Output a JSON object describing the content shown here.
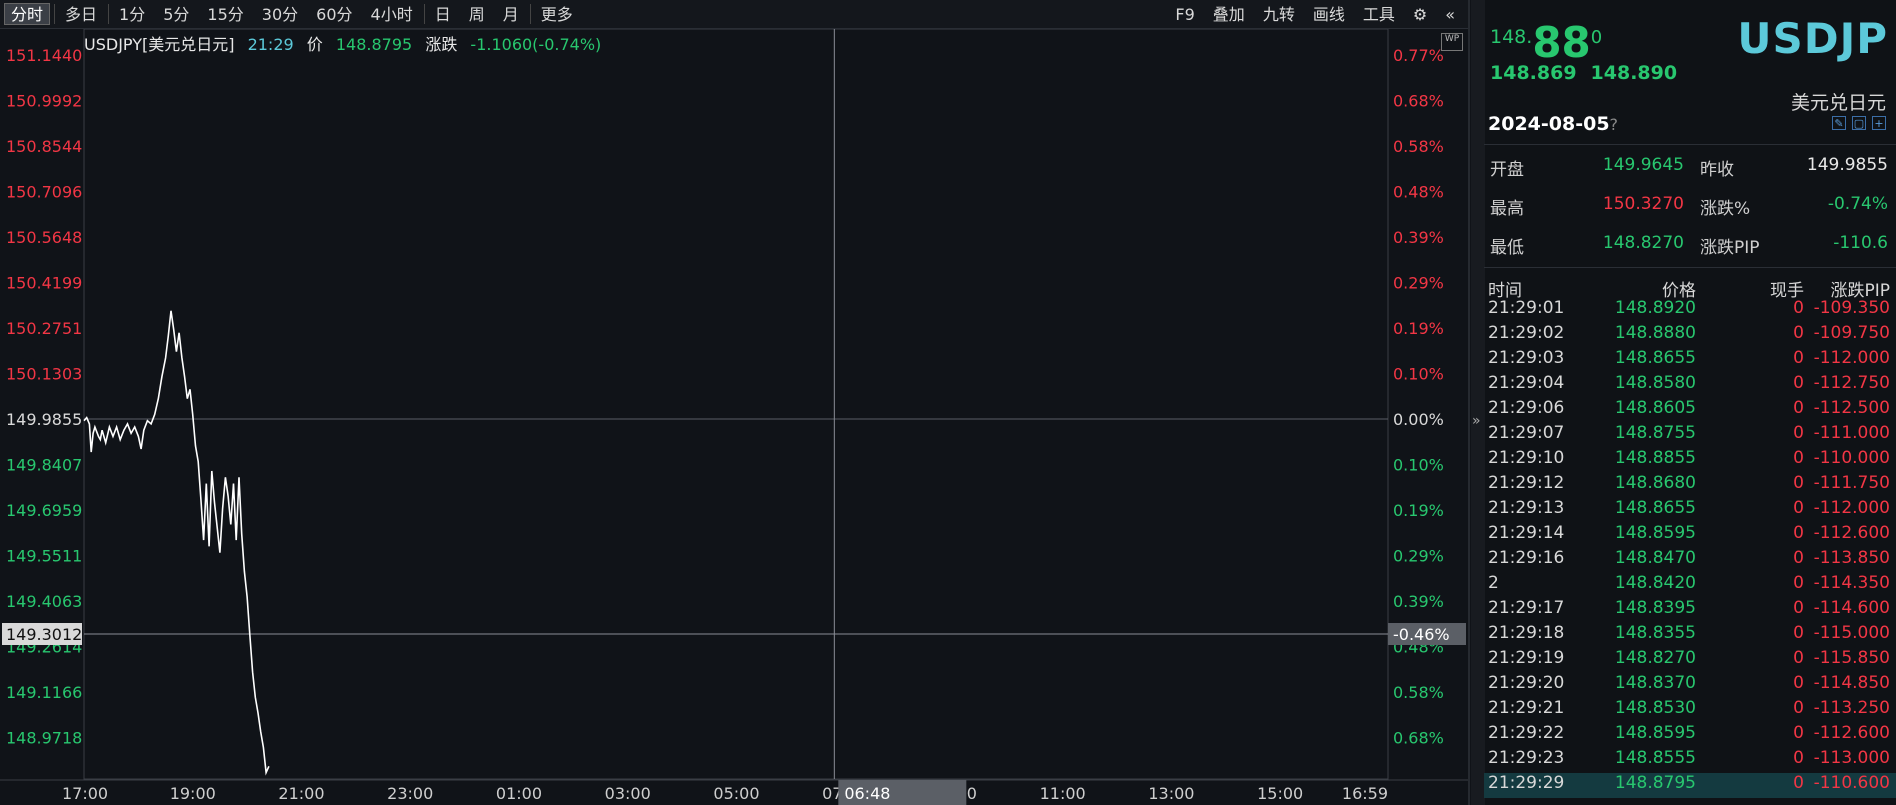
{
  "toolbar": {
    "periods": [
      {
        "label": "分时",
        "active": true
      },
      {
        "label": "多日",
        "active": false
      },
      {
        "label": "1分",
        "active": false
      },
      {
        "label": "5分",
        "active": false
      },
      {
        "label": "15分",
        "active": false
      },
      {
        "label": "30分",
        "active": false
      },
      {
        "label": "60分",
        "active": false
      },
      {
        "label": "4小时",
        "active": false
      },
      {
        "label": "日",
        "active": false
      },
      {
        "label": "周",
        "active": false
      },
      {
        "label": "月",
        "active": false
      },
      {
        "label": "更多",
        "active": false
      }
    ],
    "right": [
      "F9",
      "叠加",
      "九转",
      "画线",
      "工具"
    ],
    "settings_icon": "gear-icon",
    "collapse_icon": "double-chevron-left-icon"
  },
  "info": {
    "symbol": "USDJPY[美元兑日元]",
    "time": "21:29",
    "price_label": "价",
    "price": "148.8795",
    "change_label": "涨跌",
    "change": "-1.1060(-0.74%)"
  },
  "badge": "WP",
  "chart_data": {
    "type": "line",
    "y_ticks": [
      "151.1440",
      "150.9992",
      "150.8544",
      "150.7096",
      "150.5648",
      "150.4199",
      "150.2751",
      "150.1303",
      "149.9855",
      "149.8407",
      "149.6959",
      "149.5511",
      "149.4063",
      "149.2614",
      "149.1166",
      "148.9718"
    ],
    "pct_ticks": [
      "0.77%",
      "0.68%",
      "0.58%",
      "0.48%",
      "0.39%",
      "0.29%",
      "0.19%",
      "0.10%",
      "0.00%",
      "0.10%",
      "0.19%",
      "0.29%",
      "0.39%",
      "0.48%",
      "0.58%",
      "0.68%"
    ],
    "x_ticks": [
      "17:00",
      "19:00",
      "21:00",
      "23:00",
      "01:00",
      "03:00",
      "05:00",
      "07:00",
      "09:00",
      "11:00",
      "13:00",
      "15:00",
      "16:59"
    ],
    "prev_close": 149.9855,
    "ylim": [
      148.85,
      151.17
    ],
    "crosshair": {
      "price_label": "149.3012",
      "pct_label": "-0.46%",
      "time_label": "06:48",
      "price": 149.3012,
      "time_min": 828
    },
    "series": [
      {
        "points": [
          [
            0,
            149.98
          ],
          [
            3,
            149.99
          ],
          [
            6,
            149.97
          ],
          [
            8,
            149.88
          ],
          [
            10,
            149.94
          ],
          [
            12,
            149.96
          ],
          [
            16,
            149.93
          ],
          [
            18,
            149.92
          ],
          [
            20,
            149.95
          ],
          [
            24,
            149.91
          ],
          [
            28,
            149.96
          ],
          [
            32,
            149.93
          ],
          [
            36,
            149.96
          ],
          [
            40,
            149.92
          ],
          [
            44,
            149.95
          ],
          [
            48,
            149.97
          ],
          [
            52,
            149.94
          ],
          [
            56,
            149.96
          ],
          [
            60,
            149.93
          ],
          [
            63,
            149.89
          ],
          [
            66,
            149.95
          ],
          [
            70,
            149.98
          ],
          [
            74,
            149.97
          ],
          [
            78,
            150.0
          ],
          [
            82,
            150.05
          ],
          [
            86,
            150.12
          ],
          [
            90,
            150.18
          ],
          [
            93,
            150.25
          ],
          [
            96,
            150.33
          ],
          [
            99,
            150.27
          ],
          [
            102,
            150.2
          ],
          [
            105,
            150.26
          ],
          [
            108,
            150.18
          ],
          [
            111,
            150.12
          ],
          [
            114,
            150.05
          ],
          [
            117,
            150.08
          ],
          [
            120,
            150.0
          ],
          [
            123,
            149.9
          ],
          [
            126,
            149.85
          ],
          [
            129,
            149.73
          ],
          [
            132,
            149.6
          ],
          [
            135,
            149.78
          ],
          [
            138,
            149.58
          ],
          [
            141,
            149.82
          ],
          [
            144,
            149.72
          ],
          [
            147,
            149.64
          ],
          [
            150,
            149.56
          ],
          [
            153,
            149.7
          ],
          [
            156,
            149.8
          ],
          [
            159,
            149.74
          ],
          [
            162,
            149.65
          ],
          [
            165,
            149.78
          ],
          [
            168,
            149.6
          ],
          [
            171,
            149.8
          ],
          [
            174,
            149.62
          ],
          [
            177,
            149.5
          ],
          [
            180,
            149.42
          ],
          [
            183,
            149.3
          ],
          [
            186,
            149.18
          ],
          [
            189,
            149.1
          ],
          [
            192,
            149.05
          ],
          [
            195,
            148.99
          ],
          [
            198,
            148.94
          ],
          [
            201,
            148.86
          ],
          [
            204,
            148.88
          ]
        ]
      }
    ]
  },
  "panel": {
    "bid_small": "148.",
    "bid_big": "88",
    "bid_tail": "0",
    "symbol": "USDJP",
    "bid": "148.869",
    "ask": "148.890",
    "cname": "美元兑日元",
    "date": "2024-08-05",
    "date_q": "?",
    "quote": {
      "open_label": "开盘",
      "open": "149.9645",
      "prev_label": "昨收",
      "prev": "149.9855",
      "high_label": "最高",
      "high": "150.3270",
      "pct_label": "涨跌%",
      "pct": "-0.74%",
      "low_label": "最低",
      "low": "148.8270",
      "pip_label": "涨跌PIP",
      "pip": "-110.6"
    },
    "ticks_head": {
      "time": "时间",
      "price": "价格",
      "vol": "现手",
      "pip": "涨跌PIP"
    },
    "ticks": [
      {
        "time": "21:29:01",
        "price": "148.8920",
        "vol": "0",
        "pip": "-109.350"
      },
      {
        "time": "21:29:02",
        "price": "148.8880",
        "vol": "0",
        "pip": "-109.750"
      },
      {
        "time": "21:29:03",
        "price": "148.8655",
        "vol": "0",
        "pip": "-112.000"
      },
      {
        "time": "21:29:04",
        "price": "148.8580",
        "vol": "0",
        "pip": "-112.750"
      },
      {
        "time": "21:29:06",
        "price": "148.8605",
        "vol": "0",
        "pip": "-112.500"
      },
      {
        "time": "21:29:07",
        "price": "148.8755",
        "vol": "0",
        "pip": "-111.000"
      },
      {
        "time": "21:29:10",
        "price": "148.8855",
        "vol": "0",
        "pip": "-110.000"
      },
      {
        "time": "21:29:12",
        "price": "148.8680",
        "vol": "0",
        "pip": "-111.750"
      },
      {
        "time": "21:29:13",
        "price": "148.8655",
        "vol": "0",
        "pip": "-112.000"
      },
      {
        "time": "21:29:14",
        "price": "148.8595",
        "vol": "0",
        "pip": "-112.600"
      },
      {
        "time": "21:29:16",
        "price": "148.8470",
        "vol": "0",
        "pip": "-113.850"
      },
      {
        "time": "2",
        "price": "148.8420",
        "vol": "0",
        "pip": "-114.350"
      },
      {
        "time": "21:29:17",
        "price": "148.8395",
        "vol": "0",
        "pip": "-114.600"
      },
      {
        "time": "21:29:18",
        "price": "148.8355",
        "vol": "0",
        "pip": "-115.000"
      },
      {
        "time": "21:29:19",
        "price": "148.8270",
        "vol": "0",
        "pip": "-115.850"
      },
      {
        "time": "21:29:20",
        "price": "148.8370",
        "vol": "0",
        "pip": "-114.850"
      },
      {
        "time": "21:29:21",
        "price": "148.8530",
        "vol": "0",
        "pip": "-113.250"
      },
      {
        "time": "21:29:22",
        "price": "148.8595",
        "vol": "0",
        "pip": "-112.600"
      },
      {
        "time": "21:29:23",
        "price": "148.8555",
        "vol": "0",
        "pip": "-113.000"
      },
      {
        "time": "21:29:29",
        "price": "148.8795",
        "vol": "0",
        "pip": "-110.600"
      }
    ]
  }
}
